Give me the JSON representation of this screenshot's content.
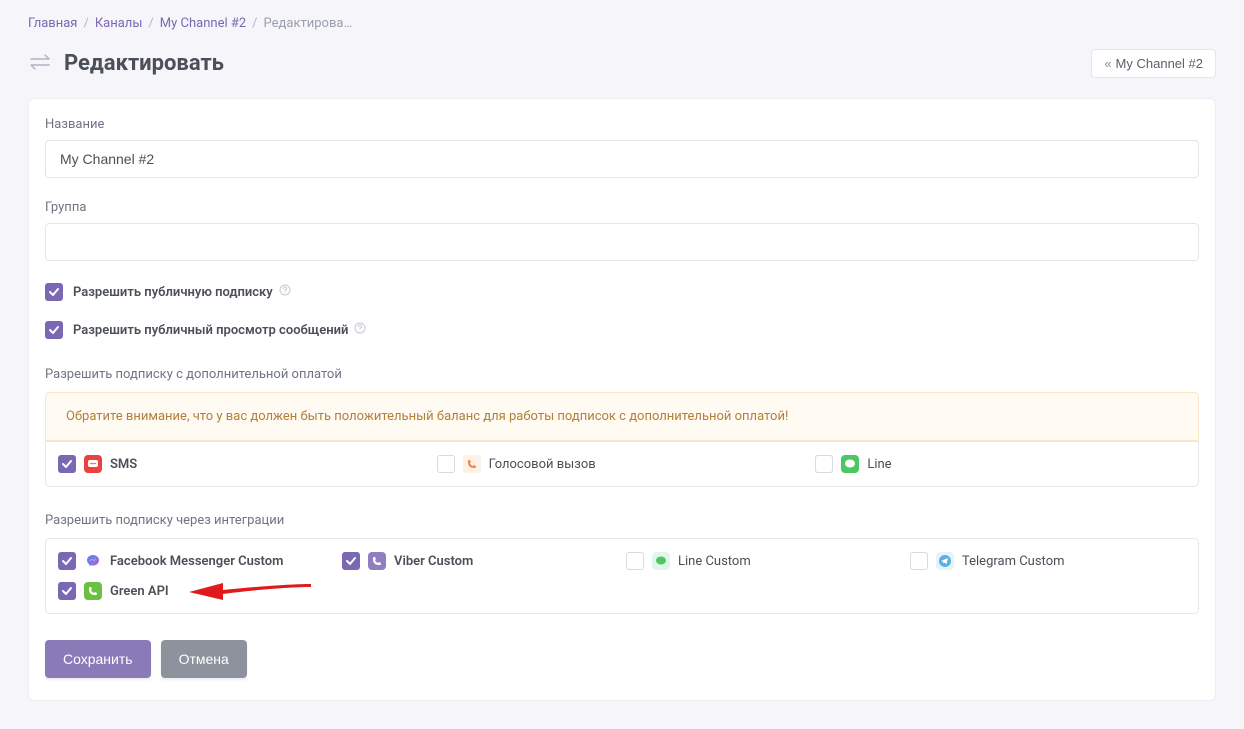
{
  "breadcrumb": {
    "home": "Главная",
    "channels": "Каналы",
    "channel": "My Channel #2",
    "current": "Редактирова…"
  },
  "title": "Редактировать",
  "back_label": "My Channel #2",
  "form": {
    "name_label": "Название",
    "name_value": "My Channel #2",
    "group_label": "Группа",
    "group_value": ""
  },
  "checks": {
    "public_subscribe": "Разрешить публичную подписку",
    "public_view": "Разрешить публичный просмотр сообщений"
  },
  "paid": {
    "section": "Разрешить подписку с дополнительной оплатой",
    "warn": "Обратите внимание, что у вас должен быть положительный баланс для работы подписок с дополнительной оплатой!",
    "sms": "SMS",
    "voice": "Голосовой вызов",
    "line": "Line"
  },
  "integrations": {
    "section": "Разрешить подписку через интеграции",
    "fb": "Facebook Messenger Custom",
    "viber": "Viber Custom",
    "linec": "Line Custom",
    "tg": "Telegram Custom",
    "green": "Green API"
  },
  "buttons": {
    "save": "Сохранить",
    "cancel": "Отмена"
  }
}
